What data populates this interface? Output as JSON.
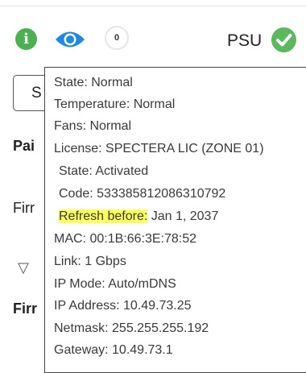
{
  "toolbar": {
    "info_glyph": "i",
    "count_value": "0",
    "psu_label": "PSU"
  },
  "background": {
    "select_text": "S",
    "label_pairing": "Pai",
    "label_firmware_1": "Firr",
    "label_firmware_2": "Firr",
    "triangle_glyph": "▽"
  },
  "tooltip": {
    "state": "State: Normal",
    "temperature": "Temperature: Normal",
    "fans": "Fans: Normal",
    "license": "License: SPECTERA LIC (ZONE 01)",
    "license_state": "State: Activated",
    "license_code": "Code: 533385812086310792",
    "refresh_label": "Refresh before:",
    "refresh_value": " Jan 1, 2037",
    "mac": "MAC: 00:1B:66:3E:78:52",
    "link": "Link: 1 Gbps",
    "ip_mode": "IP Mode: Auto/mDNS",
    "ip_address": "IP Address: 10.49.73.25",
    "netmask": "Netmask: 255.255.255.192",
    "gateway": "Gateway: 10.49.73.1"
  },
  "colors": {
    "status_green": "#4caf50",
    "eye_blue": "#1e88e5",
    "highlight": "#ffff5e"
  }
}
